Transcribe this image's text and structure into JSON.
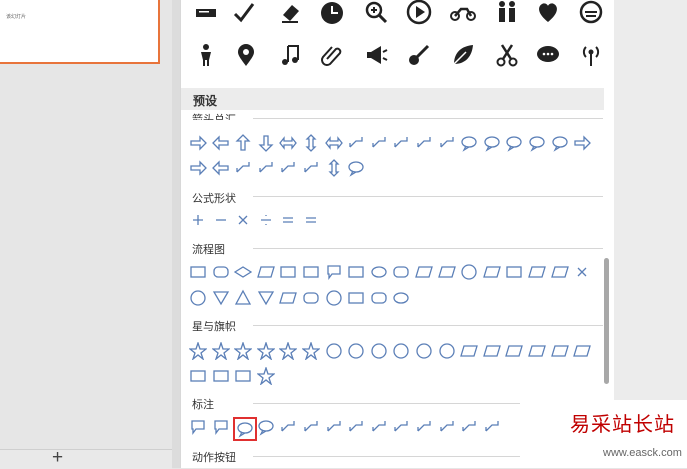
{
  "slide_thumbnail": {
    "caption": "该幻灯片"
  },
  "panel": {
    "preset_header": "预设",
    "categories": [
      {
        "label": "箭头总汇"
      },
      {
        "label": "公式形状"
      },
      {
        "label": "流程图"
      },
      {
        "label": "星与旗帜"
      },
      {
        "label": "标注"
      },
      {
        "label": "动作按钮"
      }
    ]
  },
  "bottom_bar": {
    "add_symbol": "+"
  },
  "watermark": {
    "brand": "易采站长站",
    "url": "www.easck.com"
  },
  "colors": {
    "accent": "#e8743b",
    "shape_stroke": "#5b7fb7",
    "selected": "#e03030",
    "watermark": "#c00000"
  }
}
